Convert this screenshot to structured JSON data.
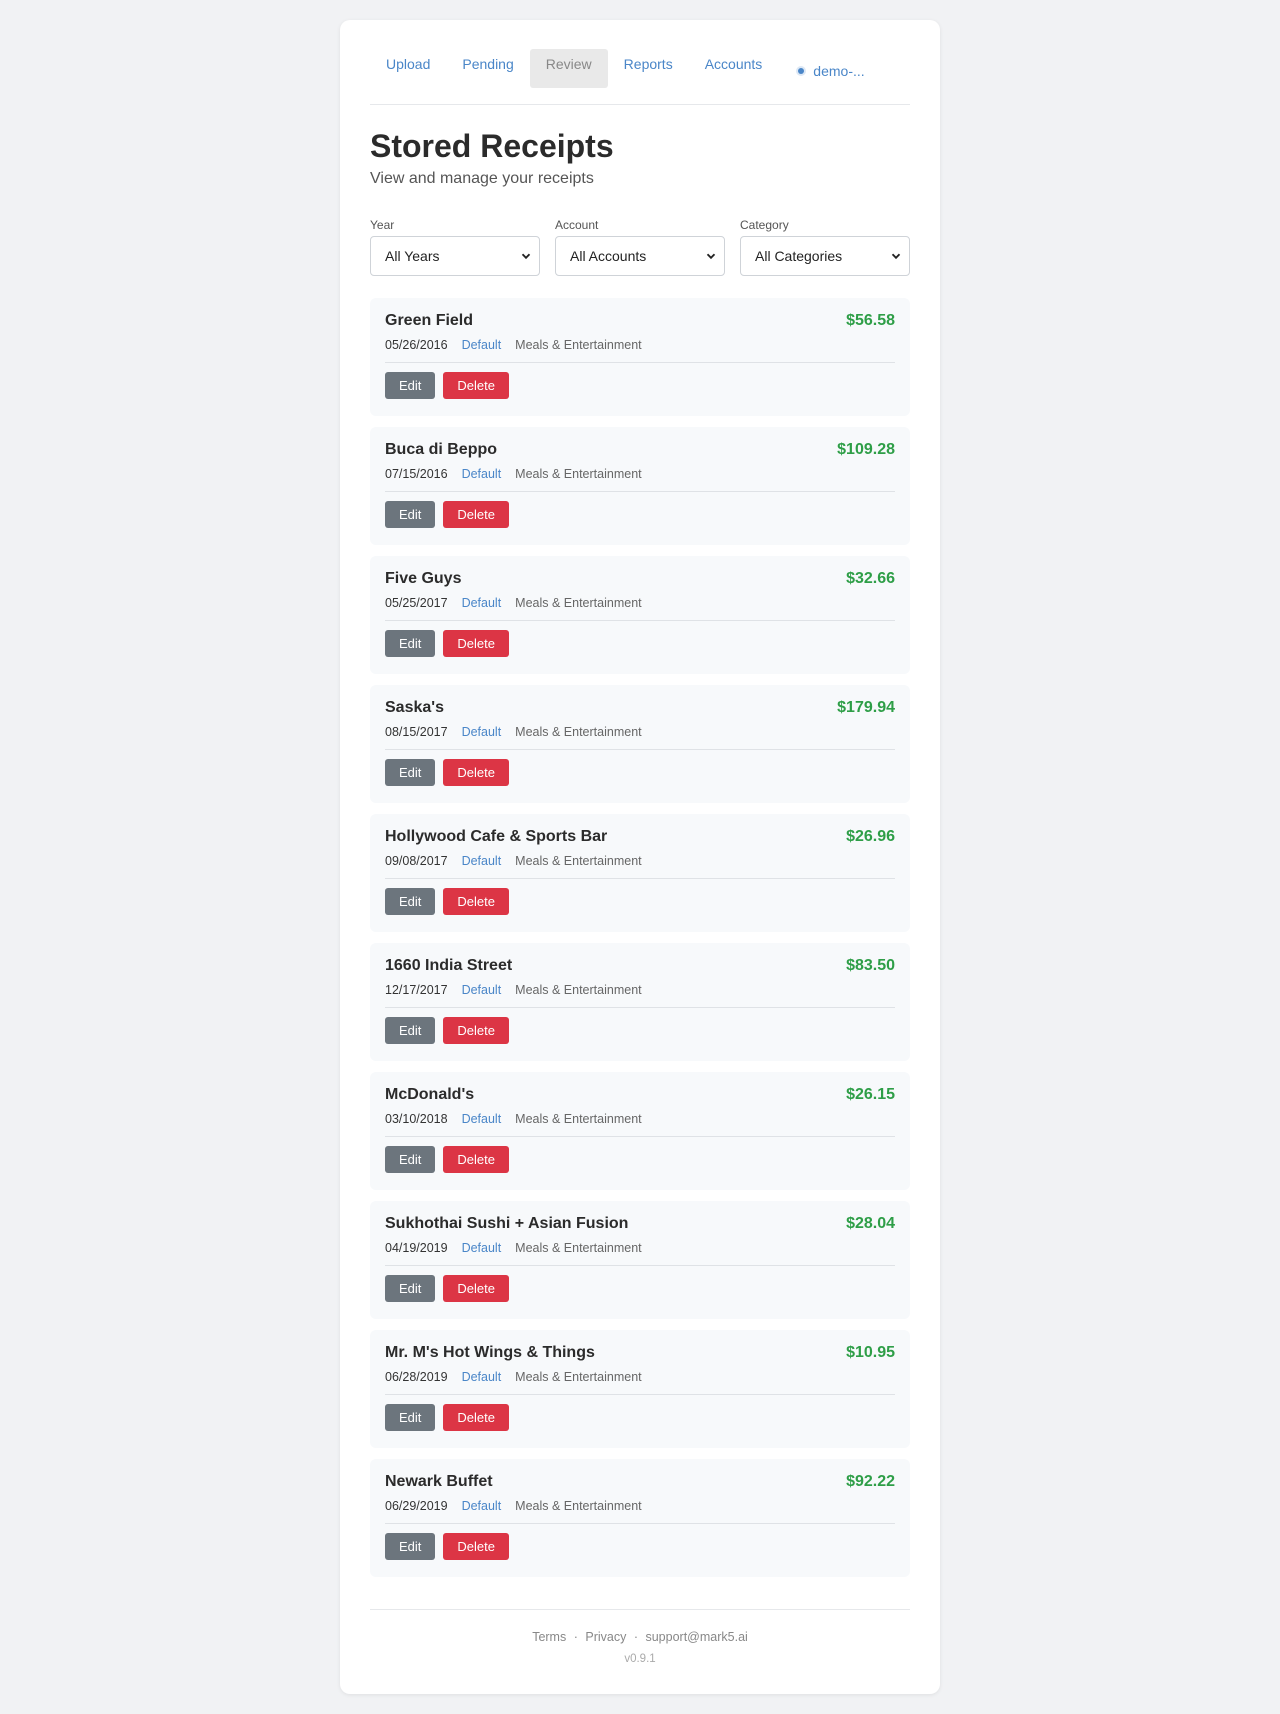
{
  "nav": {
    "items": [
      {
        "label": "Upload",
        "active": false
      },
      {
        "label": "Pending",
        "active": false
      },
      {
        "label": "Review",
        "active": true
      },
      {
        "label": "Reports",
        "active": false
      },
      {
        "label": "Accounts",
        "active": false
      }
    ],
    "user_label": "demo-..."
  },
  "page": {
    "title": "Stored Receipts",
    "subtitle": "View and manage your receipts"
  },
  "filters": {
    "year": {
      "label": "Year",
      "value": "All Years"
    },
    "account": {
      "label": "Account",
      "value": "All Accounts"
    },
    "category": {
      "label": "Category",
      "value": "All Categories"
    }
  },
  "receipt_actions": {
    "edit": "Edit",
    "delete": "Delete"
  },
  "receipts": [
    {
      "name": "Green Field",
      "amount": "$56.58",
      "date": "05/26/2016",
      "account": "Default",
      "category": "Meals & Entertainment"
    },
    {
      "name": "Buca di Beppo",
      "amount": "$109.28",
      "date": "07/15/2016",
      "account": "Default",
      "category": "Meals & Entertainment"
    },
    {
      "name": "Five Guys",
      "amount": "$32.66",
      "date": "05/25/2017",
      "account": "Default",
      "category": "Meals & Entertainment"
    },
    {
      "name": "Saska's",
      "amount": "$179.94",
      "date": "08/15/2017",
      "account": "Default",
      "category": "Meals & Entertainment"
    },
    {
      "name": "Hollywood Cafe & Sports Bar",
      "amount": "$26.96",
      "date": "09/08/2017",
      "account": "Default",
      "category": "Meals & Entertainment"
    },
    {
      "name": "1660 India Street",
      "amount": "$83.50",
      "date": "12/17/2017",
      "account": "Default",
      "category": "Meals & Entertainment"
    },
    {
      "name": "McDonald's",
      "amount": "$26.15",
      "date": "03/10/2018",
      "account": "Default",
      "category": "Meals & Entertainment"
    },
    {
      "name": "Sukhothai Sushi + Asian Fusion",
      "amount": "$28.04",
      "date": "04/19/2019",
      "account": "Default",
      "category": "Meals & Entertainment"
    },
    {
      "name": "Mr. M's Hot Wings & Things",
      "amount": "$10.95",
      "date": "06/28/2019",
      "account": "Default",
      "category": "Meals & Entertainment"
    },
    {
      "name": "Newark Buffet",
      "amount": "$92.22",
      "date": "06/29/2019",
      "account": "Default",
      "category": "Meals & Entertainment"
    }
  ],
  "footer": {
    "terms": "Terms",
    "privacy": "Privacy",
    "separator": "·",
    "support": "support@mark5.ai",
    "version": "v0.9.1"
  },
  "colors": {
    "accent": "#4a86c8",
    "amount": "#2e9e47",
    "edit_button": "#6c757d",
    "delete_button": "#dc3545"
  },
  "icons": {
    "select_arrow": "chevron-down-icon",
    "user_status": "status-dot-icon"
  }
}
